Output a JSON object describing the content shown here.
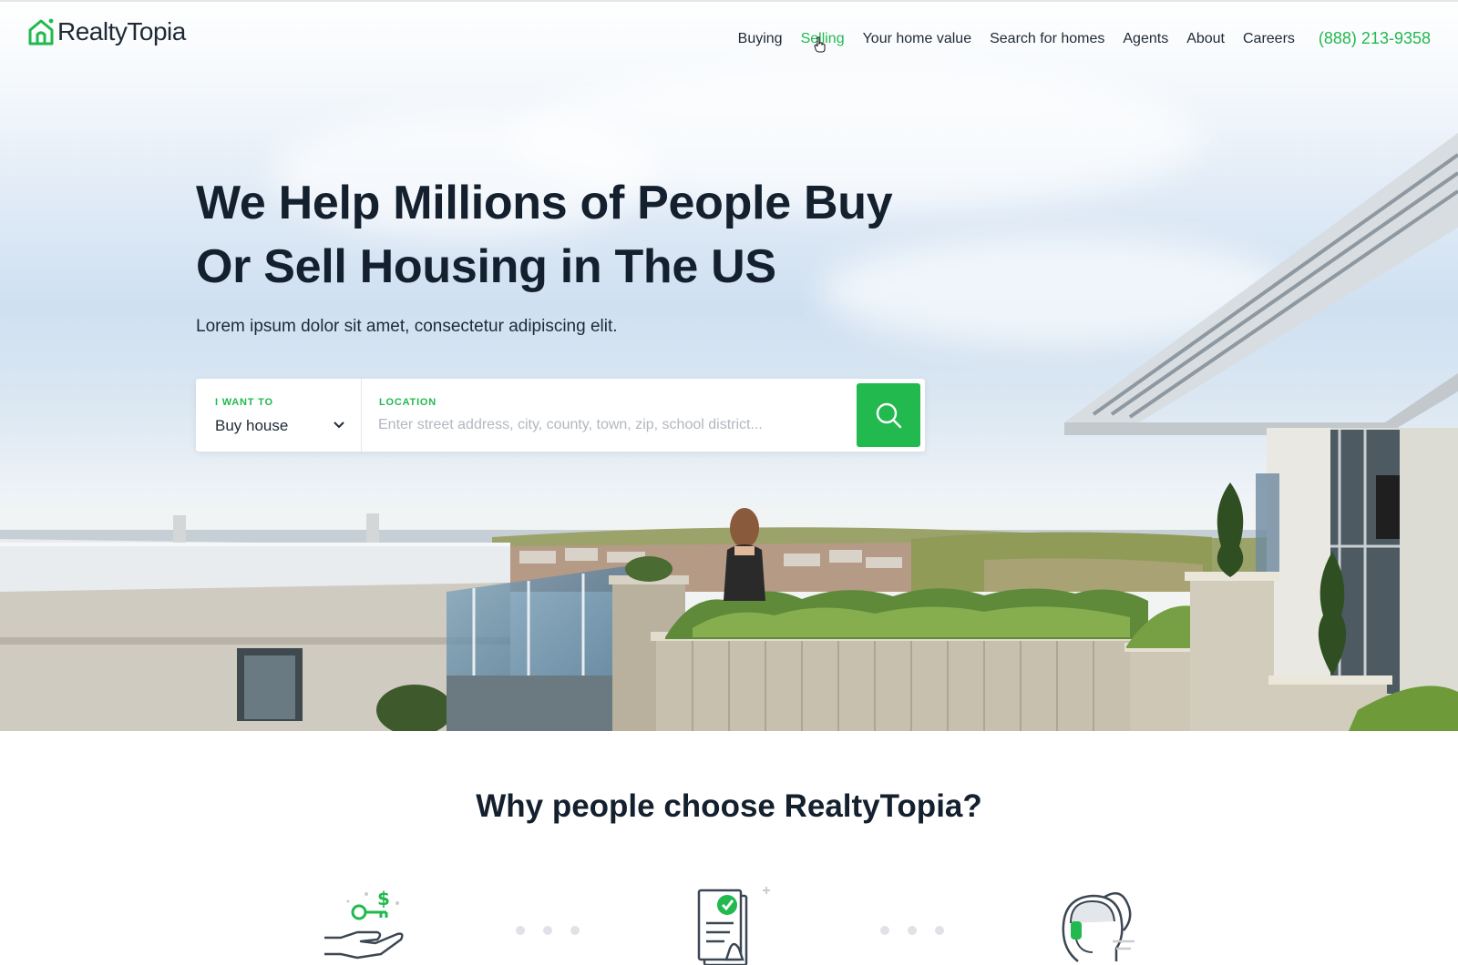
{
  "brand": {
    "name": "RealtyTopia",
    "accent_color": "#22b94f",
    "logo_icon": "house-icon"
  },
  "nav": {
    "items": [
      {
        "label": "Buying",
        "active": false
      },
      {
        "label": "Selling",
        "active": true
      },
      {
        "label": "Your home value",
        "active": false
      },
      {
        "label": "Search for homes",
        "active": false
      },
      {
        "label": "Agents",
        "active": false
      },
      {
        "label": "About",
        "active": false
      },
      {
        "label": "Careers",
        "active": false
      }
    ],
    "phone": "(888) 213-9358"
  },
  "hero": {
    "headline_line1": "We Help Millions of People Buy",
    "headline_line2": "Or Sell Housing in The US",
    "subtitle": "Lorem ipsum dolor sit amet, consectetur adipiscing elit."
  },
  "search": {
    "want_label": "I WANT TO",
    "want_value": "Buy house",
    "location_label": "LOCATION",
    "location_placeholder": "Enter street address, city, county, town, zip, school district...",
    "button_icon": "search-icon"
  },
  "why": {
    "title": "Why people choose RealtyTopia?",
    "features": [
      {
        "icon": "hand-key-dollar-icon"
      },
      {
        "icon": "approved-document-icon"
      },
      {
        "icon": "support-agent-headset-icon"
      }
    ]
  }
}
